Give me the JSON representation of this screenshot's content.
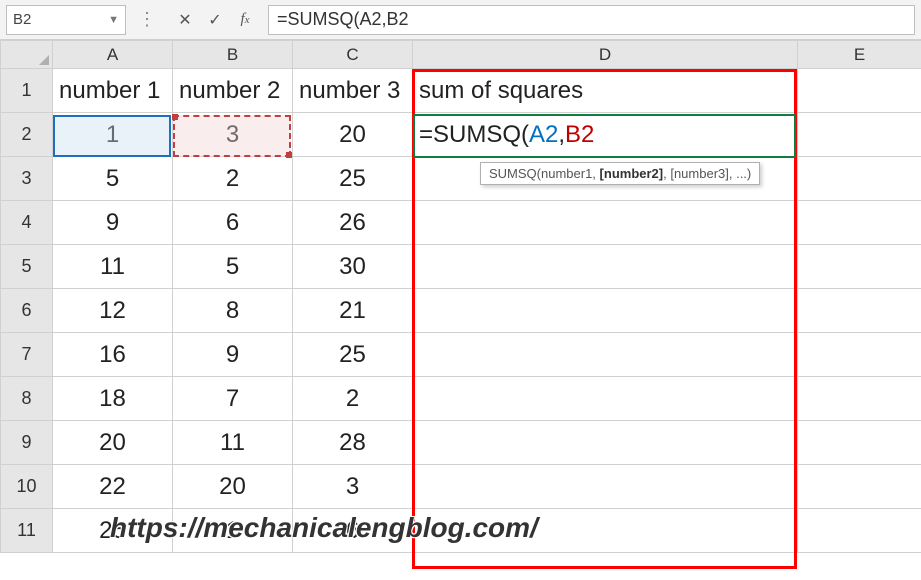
{
  "nameBox": "B2",
  "formulaBar": "=SUMSQ(A2,B2",
  "tooltip": {
    "fn": "SUMSQ",
    "args": "(number1, [number2], [number3], ...)",
    "bold": "[number2]"
  },
  "columns": [
    "A",
    "B",
    "C",
    "D",
    "E"
  ],
  "headers": {
    "A": "number 1",
    "B": "number 2",
    "C": "number 3",
    "D": "sum of squares"
  },
  "rows": [
    {
      "n": 1
    },
    {
      "n": 2,
      "A": "1",
      "B": "3",
      "C": "20",
      "D_formula": {
        "prefix": "=SUMSQ(",
        "ref1": "A2",
        "sep": ",",
        "ref2": "B2"
      }
    },
    {
      "n": 3,
      "A": "5",
      "B": "2",
      "C": "25"
    },
    {
      "n": 4,
      "A": "9",
      "B": "6",
      "C": "26"
    },
    {
      "n": 5,
      "A": "11",
      "B": "5",
      "C": "30"
    },
    {
      "n": 6,
      "A": "12",
      "B": "8",
      "C": "21"
    },
    {
      "n": 7,
      "A": "16",
      "B": "9",
      "C": "25"
    },
    {
      "n": 8,
      "A": "18",
      "B": "7",
      "C": "2"
    },
    {
      "n": 9,
      "A": "20",
      "B": "11",
      "C": "28"
    },
    {
      "n": 10,
      "A": "22",
      "B": "20",
      "C": "3"
    },
    {
      "n": 11,
      "A": "25",
      "B": "1",
      "C": "6"
    }
  ],
  "watermark": "https://mechanicalengblog.com/",
  "chart_data": {
    "type": "table",
    "title": "sum of squares",
    "columns": [
      "number 1",
      "number 2",
      "number 3"
    ],
    "data": [
      [
        1,
        3,
        20
      ],
      [
        5,
        2,
        25
      ],
      [
        9,
        6,
        26
      ],
      [
        11,
        5,
        30
      ],
      [
        12,
        8,
        21
      ],
      [
        16,
        9,
        25
      ],
      [
        18,
        7,
        2
      ],
      [
        20,
        11,
        28
      ],
      [
        22,
        20,
        3
      ],
      [
        25,
        1,
        6
      ]
    ],
    "formula_in_D2": "=SUMSQ(A2,B2"
  }
}
